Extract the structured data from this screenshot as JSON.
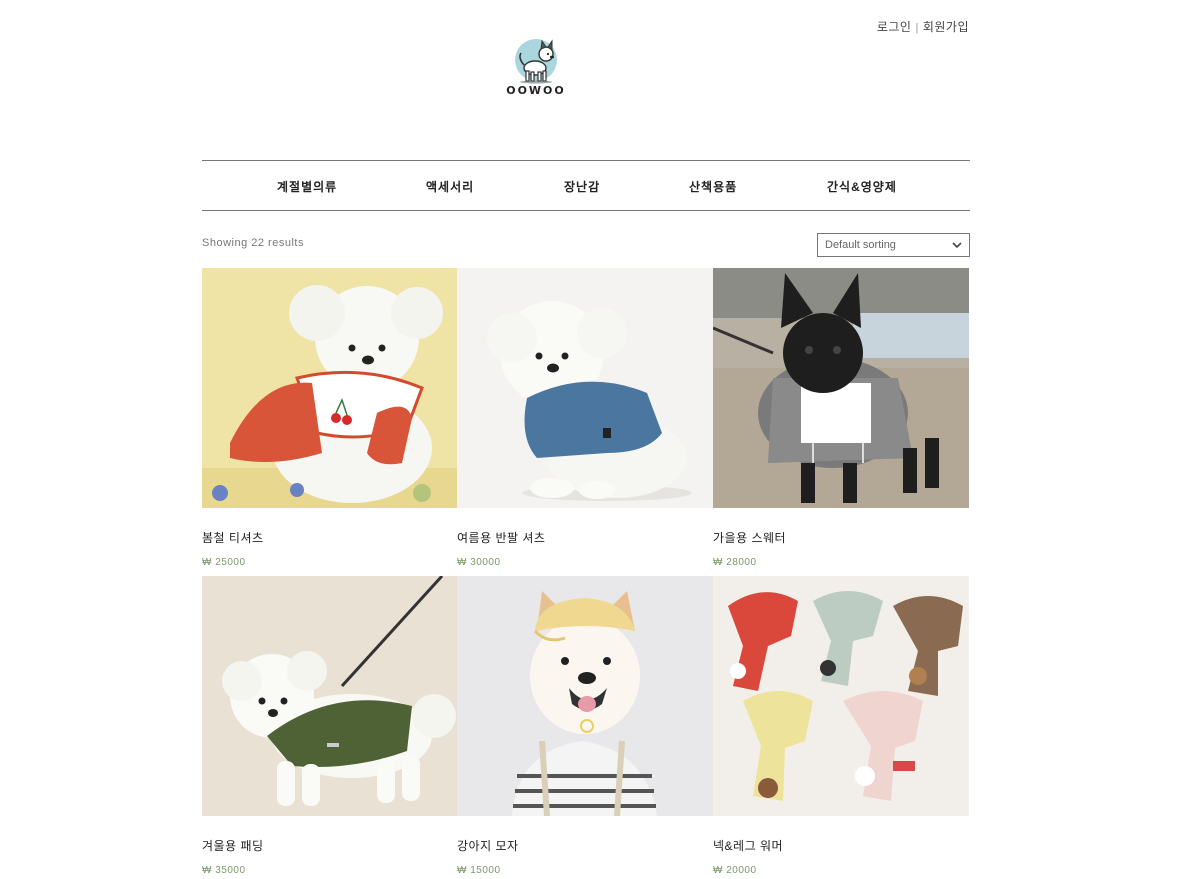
{
  "header": {
    "login_label": "로그인",
    "separator": "|",
    "signup_label": "회원가입",
    "logo_text": "OOWOO"
  },
  "nav": {
    "items": [
      {
        "label": "계절별의류"
      },
      {
        "label": "액세서리"
      },
      {
        "label": "장난감"
      },
      {
        "label": "산책용품"
      },
      {
        "label": "간식&영양제"
      }
    ]
  },
  "shop": {
    "results_text": "Showing 22 results",
    "sort_selected": "Default sorting"
  },
  "products": [
    {
      "name": "봄철 티셔츠",
      "price": "₩ 25000",
      "image_icon": "dog-red-dress-photo"
    },
    {
      "name": "여름용 반팔 셔츠",
      "price": "₩ 30000",
      "image_icon": "dog-blue-shirt-photo"
    },
    {
      "name": "가을용 스웨터",
      "price": "₩ 28000",
      "image_icon": "bulldog-grey-sweater-photo"
    },
    {
      "name": "겨울용 패딩",
      "price": "₩ 35000",
      "image_icon": "dog-green-padding-photo"
    },
    {
      "name": "강아지 모자",
      "price": "₩ 15000",
      "image_icon": "shiba-cap-photo"
    },
    {
      "name": "넥&레그 워머",
      "price": "₩ 20000",
      "image_icon": "scarves-photo"
    }
  ],
  "colors": {
    "price_green": "#7a9a6a",
    "rule_grey": "#777777",
    "text_dark": "#222222"
  }
}
